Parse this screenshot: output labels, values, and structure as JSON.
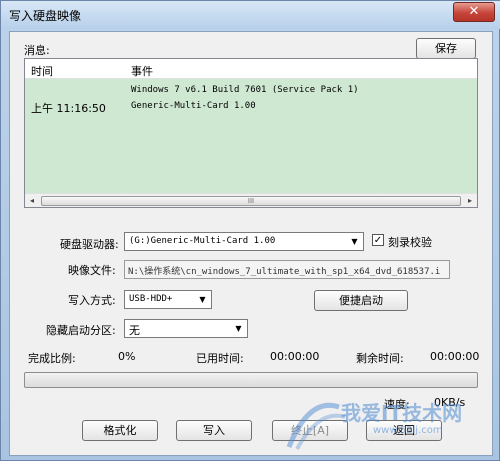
{
  "window": {
    "title": "写入硬盘映像",
    "close_glyph": "✕"
  },
  "messages": {
    "label": "消息:",
    "save_label": "保存",
    "columns": [
      "时间",
      "事件"
    ],
    "rows": [
      {
        "time": "",
        "event": "Windows 7 v6.1 Build 7601 (Service Pack 1)"
      },
      {
        "time": "上午 11:16:50",
        "event": "Generic-Multi-Card      1.00"
      }
    ],
    "scroll_thumb_glyph": "III"
  },
  "drive": {
    "label": "硬盘驱动器:",
    "value": "(G:)Generic-Multi-Card      1.00"
  },
  "verify": {
    "label": "刻录校验",
    "checked": true,
    "check_glyph": "✓"
  },
  "image_file": {
    "label": "映像文件:",
    "value": "N:\\操作系统\\cn_windows_7_ultimate_with_sp1_x64_dvd_618537.i"
  },
  "write_method": {
    "label": "写入方式:",
    "value": "USB-HDD+"
  },
  "quick_boot": {
    "label": "便捷启动"
  },
  "hidden_partition": {
    "label": "隐藏启动分区:",
    "value": "无"
  },
  "status": {
    "completed_label": "完成比例:",
    "completed_value": "0%",
    "elapsed_label": "已用时间:",
    "elapsed_value": "00:00:00",
    "remaining_label": "剩余时间:",
    "remaining_value": "00:00:00",
    "progress": 0,
    "speed_label": "速度:",
    "speed_value": "0KB/s"
  },
  "buttons": {
    "format": "格式化",
    "write": "写入",
    "abort": "终止[A]",
    "back": "返回"
  },
  "watermark": {
    "text": "我爱IT技术网",
    "url": "www.52ij.com"
  },
  "icons": {
    "dropdown": "▼",
    "left_arrow": "◂",
    "right_arrow": "▸"
  }
}
